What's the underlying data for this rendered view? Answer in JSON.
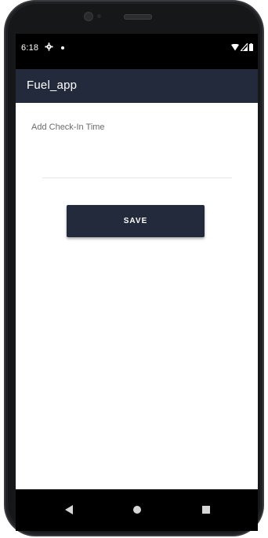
{
  "status_bar": {
    "time": "6:18",
    "settings_icon": "gear-icon",
    "notification_icon": "dot-icon",
    "wifi_icon": "wifi-icon",
    "signal_icon": "signal-icon",
    "battery_icon": "battery-icon"
  },
  "app_bar": {
    "title": "Fuel_app",
    "background": "#232a3b"
  },
  "form": {
    "check_in_label": "Add Check-In Time",
    "check_in_value": "",
    "save_label": "SAVE"
  },
  "nav_bar": {
    "back_icon": "back-triangle-icon",
    "home_icon": "home-circle-icon",
    "recents_icon": "recents-square-icon"
  },
  "colors": {
    "primary": "#232a3b",
    "label_text": "#6b6b6b"
  }
}
